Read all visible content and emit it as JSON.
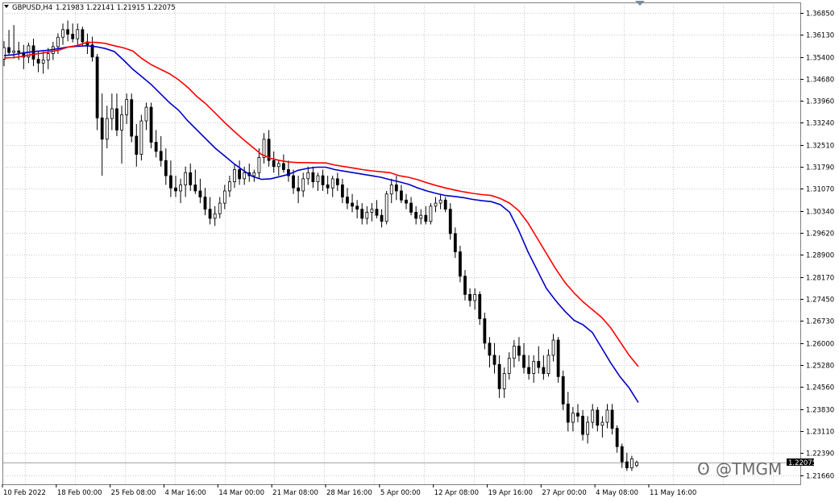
{
  "header": {
    "symbol_timeframe": "GBPUSD,H4",
    "ohlc": "1.21983 1.22141 1.21915 1.22075"
  },
  "watermark": "@TMGM",
  "current_price": "1.22075",
  "colors": {
    "ma_fast": "#0000c8",
    "ma_slow": "#ff0000",
    "candle": "#000000",
    "price_line": "#a6a6a6"
  },
  "chart_data": {
    "type": "line",
    "ylim": [
      1.2168,
      1.3685
    ],
    "yticks": [
      "1.36850",
      "1.36130",
      "1.35400",
      "1.34680",
      "1.33960",
      "1.33240",
      "1.32510",
      "1.31790",
      "1.31070",
      "1.30340",
      "1.29620",
      "1.28900",
      "1.28170",
      "1.27450",
      "1.26730",
      "1.26000",
      "1.25280",
      "1.24560",
      "1.23830",
      "1.23110",
      "1.22390",
      "1.21660"
    ],
    "x_labels": [
      "10 Feb 2022",
      "18 Feb 00:00",
      "25 Feb 08:00",
      "4 Mar 16:00",
      "14 Mar 00:00",
      "21 Mar 08:00",
      "28 Mar 16:00",
      "5 Apr 00:00",
      "12 Apr 08:00",
      "19 Apr 16:00",
      "27 Apr 00:00",
      "4 May 08:00",
      "11 May 16:00"
    ],
    "series": [
      {
        "values": [
          1.3545,
          1.3547,
          1.3553,
          1.3557,
          1.356,
          1.3563,
          1.3568,
          1.3573,
          1.3575,
          1.3577,
          1.3574,
          1.3568,
          1.3558,
          1.353,
          1.35,
          1.3475,
          1.345,
          1.342,
          1.339,
          1.3365,
          1.333,
          1.33,
          1.327,
          1.324,
          1.3215,
          1.319,
          1.3168,
          1.3148,
          1.3138,
          1.314,
          1.3147,
          1.3155,
          1.3168,
          1.3174,
          1.3178,
          1.3178,
          1.317,
          1.3165,
          1.316,
          1.3155,
          1.315,
          1.3145,
          1.3137,
          1.313,
          1.3122,
          1.311,
          1.31,
          1.3092,
          1.3085,
          1.3082,
          1.3078,
          1.3072,
          1.3068,
          1.3065,
          1.3055,
          1.303,
          1.297,
          1.29,
          1.284,
          1.278,
          1.274,
          1.2705,
          1.2675,
          1.266,
          1.2635,
          1.2585,
          1.2535,
          1.249,
          1.2453,
          1.2405
        ]
      },
      {
        "values": [
          1.3537,
          1.3538,
          1.3542,
          1.3548,
          1.3552,
          1.3557,
          1.3563,
          1.3573,
          1.3578,
          1.3588,
          1.3588,
          1.3585,
          1.3577,
          1.357,
          1.356,
          1.3535,
          1.3515,
          1.35,
          1.3485,
          1.3465,
          1.344,
          1.341,
          1.3385,
          1.3355,
          1.3325,
          1.3297,
          1.327,
          1.3245,
          1.322,
          1.3207,
          1.32,
          1.3195,
          1.3193,
          1.3193,
          1.3192,
          1.3192,
          1.3185,
          1.318,
          1.3175,
          1.317,
          1.3166,
          1.3163,
          1.316,
          1.315,
          1.3145,
          1.3137,
          1.3127,
          1.3118,
          1.311,
          1.3103,
          1.3097,
          1.3092,
          1.3088,
          1.3085,
          1.3075,
          1.306,
          1.3035,
          1.2995,
          1.2945,
          1.2895,
          1.2845,
          1.28,
          1.2765,
          1.2735,
          1.271,
          1.2685,
          1.265,
          1.2605,
          1.256,
          1.2523
        ]
      }
    ],
    "candles": [
      [
        1.3533,
        1.3592,
        1.351,
        1.3571
      ],
      [
        1.3571,
        1.3629,
        1.3548,
        1.3555
      ],
      [
        1.3555,
        1.3645,
        1.3535,
        1.356
      ],
      [
        1.356,
        1.359,
        1.353,
        1.3555
      ],
      [
        1.3555,
        1.358,
        1.35,
        1.354
      ],
      [
        1.354,
        1.3587,
        1.352,
        1.3577
      ],
      [
        1.3577,
        1.36,
        1.351,
        1.3533
      ],
      [
        1.3533,
        1.356,
        1.349,
        1.352
      ],
      [
        1.352,
        1.3558,
        1.3485,
        1.353
      ],
      [
        1.353,
        1.357,
        1.35,
        1.3551
      ],
      [
        1.3551,
        1.359,
        1.353,
        1.3574
      ],
      [
        1.3574,
        1.3618,
        1.355,
        1.3605
      ],
      [
        1.3605,
        1.365,
        1.358,
        1.363
      ],
      [
        1.363,
        1.366,
        1.3592,
        1.3615
      ],
      [
        1.3615,
        1.365,
        1.3588,
        1.36
      ],
      [
        1.36,
        1.365,
        1.3578,
        1.363
      ],
      [
        1.363,
        1.364,
        1.3578,
        1.359
      ],
      [
        1.359,
        1.3617,
        1.355,
        1.358
      ],
      [
        1.358,
        1.3607,
        1.3525,
        1.354
      ],
      [
        1.354,
        1.355,
        1.33,
        1.334
      ],
      [
        1.334,
        1.342,
        1.315,
        1.327
      ],
      [
        1.327,
        1.338,
        1.324,
        1.3338
      ],
      [
        1.3338,
        1.342,
        1.33,
        1.337
      ],
      [
        1.337,
        1.342,
        1.328,
        1.33
      ],
      [
        1.33,
        1.338,
        1.319,
        1.335
      ],
      [
        1.335,
        1.342,
        1.332,
        1.34
      ],
      [
        1.34,
        1.342,
        1.326,
        1.328
      ],
      [
        1.328,
        1.332,
        1.318,
        1.322
      ],
      [
        1.322,
        1.335,
        1.32,
        1.333
      ],
      [
        1.333,
        1.339,
        1.33,
        1.3375
      ],
      [
        1.3375,
        1.339,
        1.324,
        1.326
      ],
      [
        1.326,
        1.33,
        1.321,
        1.323
      ],
      [
        1.323,
        1.328,
        1.318,
        1.32
      ],
      [
        1.32,
        1.324,
        1.312,
        1.315
      ],
      [
        1.315,
        1.32,
        1.308,
        1.311
      ],
      [
        1.311,
        1.315,
        1.308,
        1.31
      ],
      [
        1.31,
        1.314,
        1.306,
        1.312
      ],
      [
        1.312,
        1.318,
        1.308,
        1.316
      ],
      [
        1.316,
        1.319,
        1.31,
        1.312
      ],
      [
        1.312,
        1.317,
        1.309,
        1.31
      ],
      [
        1.31,
        1.314,
        1.306,
        1.308
      ],
      [
        1.308,
        1.311,
        1.302,
        1.304
      ],
      [
        1.304,
        1.308,
        1.299,
        1.301
      ],
      [
        1.301,
        1.305,
        1.2985,
        1.3025
      ],
      [
        1.3025,
        1.308,
        1.301,
        1.306
      ],
      [
        1.306,
        1.312,
        1.304,
        1.31
      ],
      [
        1.31,
        1.315,
        1.308,
        1.313
      ],
      [
        1.313,
        1.319,
        1.311,
        1.317
      ],
      [
        1.317,
        1.32,
        1.312,
        1.314
      ],
      [
        1.314,
        1.318,
        1.312,
        1.316
      ],
      [
        1.316,
        1.319,
        1.313,
        1.315
      ],
      [
        1.315,
        1.317,
        1.313,
        1.316
      ],
      [
        1.316,
        1.324,
        1.314,
        1.321
      ],
      [
        1.321,
        1.329,
        1.319,
        1.327
      ],
      [
        1.327,
        1.33,
        1.318,
        1.32
      ],
      [
        1.32,
        1.323,
        1.316,
        1.318
      ],
      [
        1.318,
        1.32,
        1.315,
        1.319
      ],
      [
        1.319,
        1.322,
        1.316,
        1.317
      ],
      [
        1.317,
        1.32,
        1.313,
        1.315
      ],
      [
        1.315,
        1.317,
        1.309,
        1.311
      ],
      [
        1.311,
        1.315,
        1.306,
        1.31
      ],
      [
        1.31,
        1.316,
        1.308,
        1.314
      ],
      [
        1.314,
        1.318,
        1.312,
        1.316
      ],
      [
        1.316,
        1.318,
        1.311,
        1.313
      ],
      [
        1.313,
        1.316,
        1.31,
        1.315
      ],
      [
        1.315,
        1.317,
        1.31,
        1.312
      ],
      [
        1.312,
        1.315,
        1.309,
        1.311
      ],
      [
        1.311,
        1.315,
        1.308,
        1.314
      ],
      [
        1.314,
        1.316,
        1.31,
        1.312
      ],
      [
        1.312,
        1.314,
        1.306,
        1.308
      ],
      [
        1.308,
        1.311,
        1.304,
        1.306
      ],
      [
        1.306,
        1.309,
        1.303,
        1.305
      ],
      [
        1.305,
        1.307,
        1.301,
        1.304
      ],
      [
        1.304,
        1.306,
        1.299,
        1.301
      ],
      [
        1.301,
        1.305,
        1.299,
        1.303
      ],
      [
        1.303,
        1.306,
        1.3,
        1.304
      ],
      [
        1.304,
        1.307,
        1.301,
        1.302
      ],
      [
        1.302,
        1.304,
        1.298,
        1.3
      ],
      [
        1.3,
        1.31,
        1.299,
        1.309
      ],
      [
        1.309,
        1.314,
        1.306,
        1.312
      ],
      [
        1.312,
        1.315,
        1.307,
        1.31
      ],
      [
        1.31,
        1.312,
        1.306,
        1.307
      ],
      [
        1.307,
        1.309,
        1.304,
        1.306
      ],
      [
        1.306,
        1.308,
        1.302,
        1.303
      ],
      [
        1.303,
        1.305,
        1.299,
        1.301
      ],
      [
        1.301,
        1.304,
        1.299,
        1.302
      ],
      [
        1.302,
        1.305,
        1.299,
        1.3
      ],
      [
        1.3,
        1.306,
        1.299,
        1.305
      ],
      [
        1.305,
        1.308,
        1.303,
        1.306
      ],
      [
        1.306,
        1.309,
        1.304,
        1.307
      ],
      [
        1.307,
        1.308,
        1.303,
        1.304
      ],
      [
        1.304,
        1.306,
        1.294,
        1.296
      ],
      [
        1.296,
        1.298,
        1.288,
        1.29
      ],
      [
        1.29,
        1.292,
        1.28,
        1.282
      ],
      [
        1.282,
        1.284,
        1.274,
        1.276
      ],
      [
        1.276,
        1.278,
        1.272,
        1.274
      ],
      [
        1.274,
        1.278,
        1.271,
        1.276
      ],
      [
        1.276,
        1.277,
        1.266,
        1.268
      ],
      [
        1.268,
        1.27,
        1.258,
        1.26
      ],
      [
        1.26,
        1.262,
        1.252,
        1.256
      ],
      [
        1.256,
        1.26,
        1.25,
        1.253
      ],
      [
        1.253,
        1.256,
        1.242,
        1.245
      ],
      [
        1.245,
        1.252,
        1.242,
        1.25
      ],
      [
        1.25,
        1.257,
        1.248,
        1.255
      ],
      [
        1.255,
        1.261,
        1.252,
        1.259
      ],
      [
        1.259,
        1.262,
        1.254,
        1.256
      ],
      [
        1.256,
        1.26,
        1.25,
        1.252
      ],
      [
        1.252,
        1.256,
        1.248,
        1.25
      ],
      [
        1.25,
        1.256,
        1.247,
        1.254
      ],
      [
        1.254,
        1.259,
        1.25,
        1.252
      ],
      [
        1.252,
        1.256,
        1.248,
        1.25
      ],
      [
        1.25,
        1.258,
        1.249,
        1.256
      ],
      [
        1.256,
        1.263,
        1.254,
        1.261
      ],
      [
        1.261,
        1.262,
        1.247,
        1.249
      ],
      [
        1.249,
        1.251,
        1.238,
        1.24
      ],
      [
        1.24,
        1.244,
        1.231,
        1.234
      ],
      [
        1.234,
        1.239,
        1.231,
        1.237
      ],
      [
        1.237,
        1.24,
        1.234,
        1.236
      ],
      [
        1.236,
        1.238,
        1.228,
        1.23
      ],
      [
        1.23,
        1.236,
        1.227,
        1.234
      ],
      [
        1.234,
        1.24,
        1.232,
        1.238
      ],
      [
        1.238,
        1.239,
        1.231,
        1.233
      ],
      [
        1.233,
        1.236,
        1.229,
        1.234
      ],
      [
        1.234,
        1.24,
        1.232,
        1.238
      ],
      [
        1.238,
        1.24,
        1.23,
        1.232
      ],
      [
        1.232,
        1.233,
        1.224,
        1.226
      ],
      [
        1.226,
        1.227,
        1.219,
        1.221
      ],
      [
        1.221,
        1.224,
        1.218,
        1.219
      ],
      [
        1.219,
        1.223,
        1.218,
        1.222
      ],
      [
        1.2198,
        1.2214,
        1.2192,
        1.2208
      ]
    ]
  }
}
